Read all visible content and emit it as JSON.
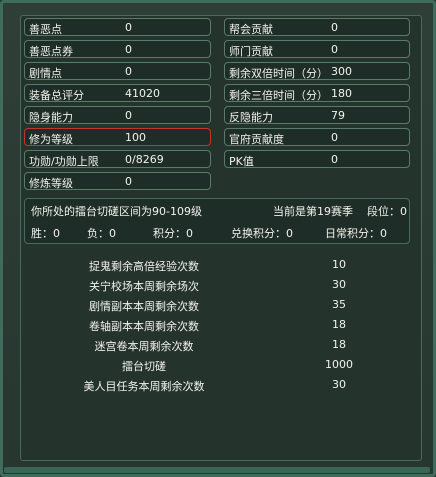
{
  "stats_left": [
    {
      "label": "善恶点",
      "value": "0"
    },
    {
      "label": "善恶点券",
      "value": "0"
    },
    {
      "label": "剧情点",
      "value": "0"
    },
    {
      "label": "装备总评分",
      "value": "41020"
    },
    {
      "label": "隐身能力",
      "value": "0"
    },
    {
      "label": "修为等级",
      "value": "100"
    },
    {
      "label": "功勋/功勋上限",
      "value": "0/8269"
    },
    {
      "label": "修炼等级",
      "value": "0"
    }
  ],
  "stats_right": [
    {
      "label": "帮会贡献",
      "value": "0"
    },
    {
      "label": "师门贡献",
      "value": "0"
    },
    {
      "label": "剩余双倍时间（分）",
      "value": "300"
    },
    {
      "label": "剩余三倍时间（分）",
      "value": "180"
    },
    {
      "label": "反隐能力",
      "value": "79"
    },
    {
      "label": "官府贡献度",
      "value": "0"
    },
    {
      "label": "PK值",
      "value": "0"
    }
  ],
  "season": {
    "range_text": "你所处的擂台切磋区间为90-109级",
    "current_season": "当前是第19赛季",
    "rank": "段位：0",
    "wins": "胜：0",
    "losses": "负：0",
    "points": "积分：0",
    "exchange_points": "兑换积分：0",
    "daily_points": "日常积分：0"
  },
  "counts": [
    {
      "label": "捉鬼剩余高倍经验次数",
      "value": "10"
    },
    {
      "label": "关宁校场本周剩余场次",
      "value": "30"
    },
    {
      "label": "剧情副本本周剩余次数",
      "value": "35"
    },
    {
      "label": "卷轴副本本周剩余次数",
      "value": "18"
    },
    {
      "label": "迷宫卷本周剩余次数",
      "value": "18"
    },
    {
      "label": "擂台切磋",
      "value": "1000"
    },
    {
      "label": "美人目任务本周剩余次数",
      "value": "30"
    }
  ]
}
